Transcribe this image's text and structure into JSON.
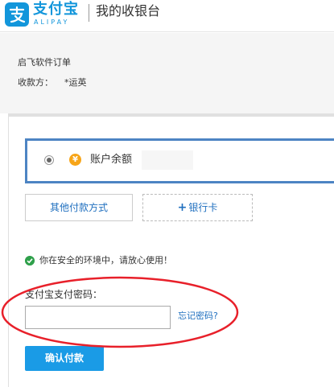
{
  "header": {
    "logo_name": "支付宝",
    "logo_sub": "ALIPAY",
    "title": "我的收银台"
  },
  "order": {
    "name": "启飞软件订单",
    "payee_label": "收款方：",
    "payee_value": "*运英"
  },
  "payment": {
    "method_label": "账户余额",
    "other_methods_label": "其他付款方式",
    "bank_card_plus": "+",
    "bank_card_label": "银行卡"
  },
  "security": {
    "message": "你在安全的环境中，请放心使用！"
  },
  "password": {
    "label": "支付宝支付密码：",
    "value": "",
    "forgot_label": "忘记密码?"
  },
  "actions": {
    "confirm_label": "确认付款"
  },
  "colors": {
    "brand": "#1296db",
    "link": "#1f6fbf",
    "primary_button": "#1a9be6",
    "selected_border": "#4d84c3",
    "annotation": "#e8202a",
    "secure": "#2fa04b",
    "balance_icon": "#f7a518"
  },
  "icons": {
    "logo": "alipay-logo-icon",
    "balance": "yen-icon",
    "secure": "check-circle-icon"
  }
}
